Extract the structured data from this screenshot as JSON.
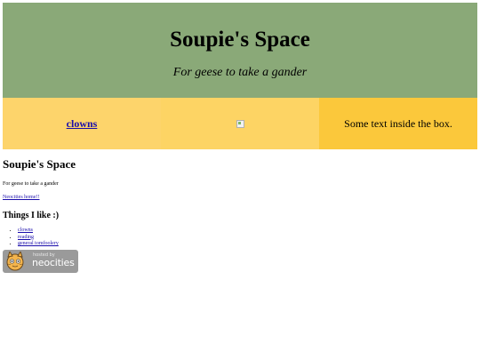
{
  "header": {
    "title": "Soupie's Space",
    "tagline": "For geese to take a gander"
  },
  "boxes": {
    "link_label": "clowns",
    "image_icon": "broken-image-icon",
    "text": "Some text inside the box."
  },
  "main": {
    "heading": "Soupie's Space",
    "subtitle": "For geese to take a gander",
    "home_link": "Neocities home!!",
    "likes_heading": "Things I like :)",
    "likes": [
      "clowns",
      "reading",
      "general tomfoolery"
    ]
  },
  "badge": {
    "hosted_by": "hosted by",
    "brand": "neocities",
    "icon": "neocities-cat-icon"
  },
  "colors": {
    "header_bg": "#8aa978",
    "box1_bg": "#fdd46b",
    "box2_bg": "#fdd464",
    "box3_bg": "#fbc83b",
    "link": "#1a0dab"
  }
}
